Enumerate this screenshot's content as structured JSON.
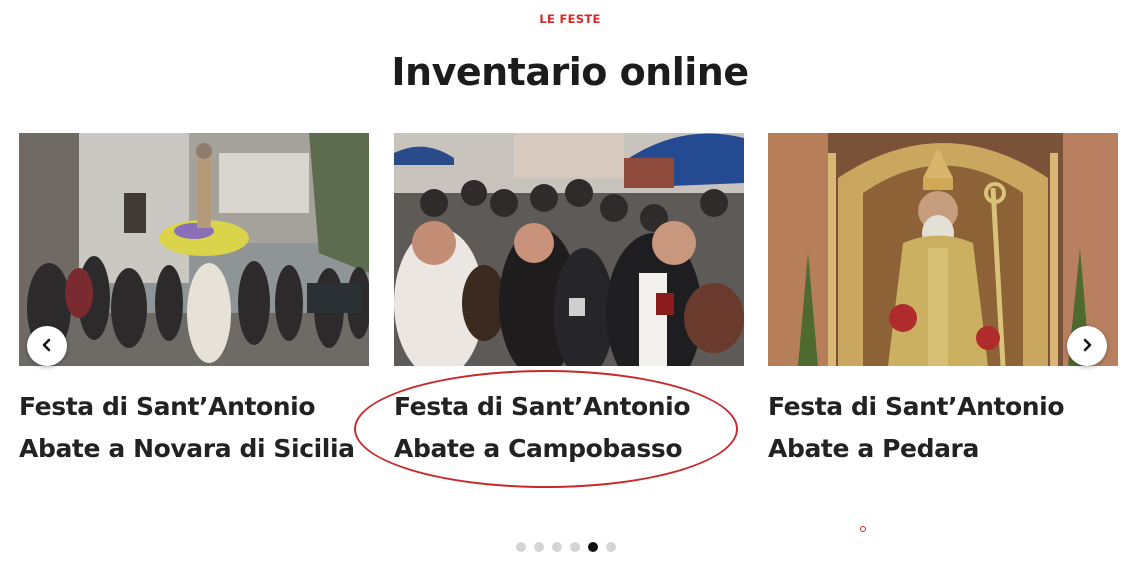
{
  "section": {
    "kicker": "LE FESTE",
    "title": "Inventario online"
  },
  "carousel": {
    "cards": [
      {
        "title_line1": "Festa di Sant’Antonio",
        "title_line2": "Abate a Novara di Sicilia",
        "image": "procession-photo"
      },
      {
        "title_line1": "Festa di Sant’Antonio",
        "title_line2": "Abate a Campobasso",
        "image": "blessing-of-animals-photo"
      },
      {
        "title_line1": "Festa di Sant’Antonio",
        "title_line2": "Abate a Pedara",
        "image": "saint-statue-altar-photo"
      }
    ],
    "prev_icon": "chevron-left-icon",
    "next_icon": "chevron-right-icon",
    "dots_count": 6,
    "active_dot": 5
  },
  "colors": {
    "accent": "#d42a2a",
    "annotation": "#c62a2a",
    "title": "#1c1c1c"
  }
}
